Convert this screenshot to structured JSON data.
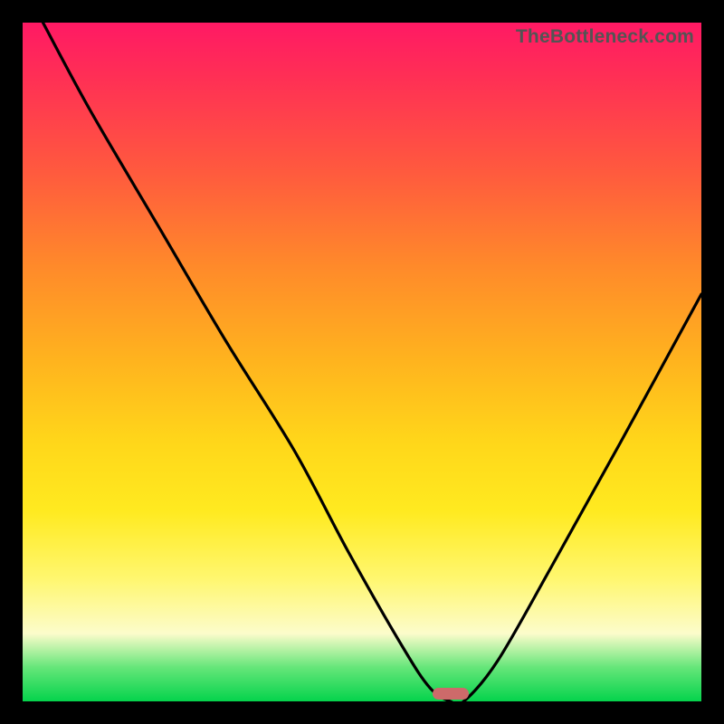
{
  "watermark": "TheBottleneck.com",
  "chart_data": {
    "type": "line",
    "title": "",
    "xlabel": "",
    "ylabel": "",
    "xlim": [
      0,
      100
    ],
    "ylim": [
      0,
      100
    ],
    "grid": false,
    "legend": false,
    "series": [
      {
        "name": "bottleneck-curve",
        "x": [
          3,
          10,
          20,
          30,
          40,
          48,
          56,
          60,
          63,
          65,
          70,
          78,
          88,
          100
        ],
        "y": [
          100,
          87,
          70,
          53,
          37,
          22,
          8,
          2,
          0,
          0,
          6,
          20,
          38,
          60
        ]
      }
    ],
    "annotations": [
      {
        "name": "optimal-marker",
        "x": 63,
        "y": 0,
        "shape": "pill",
        "color": "#cd6a6a"
      }
    ],
    "background_gradient": {
      "direction": "vertical",
      "stops": [
        {
          "pos": 0.0,
          "color": "#ff1964"
        },
        {
          "pos": 0.22,
          "color": "#ff5a3e"
        },
        {
          "pos": 0.5,
          "color": "#ffb41e"
        },
        {
          "pos": 0.72,
          "color": "#ffea20"
        },
        {
          "pos": 0.9,
          "color": "#fcfccb"
        },
        {
          "pos": 0.95,
          "color": "#65e679"
        },
        {
          "pos": 1.0,
          "color": "#05d34c"
        }
      ]
    }
  }
}
